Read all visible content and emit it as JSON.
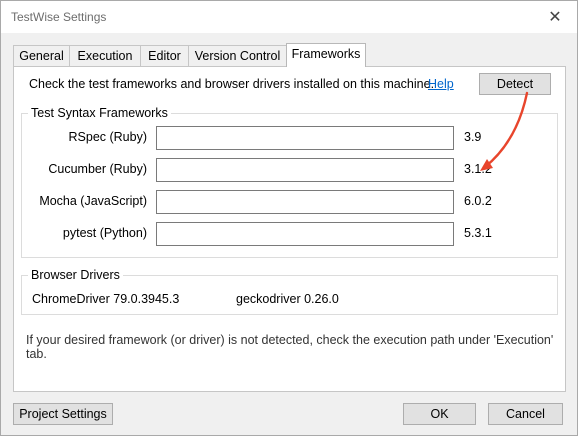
{
  "window": {
    "title": "TestWise Settings"
  },
  "tabs": [
    {
      "label": "General"
    },
    {
      "label": "Execution"
    },
    {
      "label": "Editor"
    },
    {
      "label": "Version Control"
    },
    {
      "label": "Frameworks",
      "active": true
    }
  ],
  "frameworks_tab": {
    "intro": "Check the test frameworks and browser drivers installed on this machine.",
    "help_link": "Help",
    "detect_button": "Detect",
    "syntax_group": {
      "label": "Test Syntax Frameworks",
      "rows": [
        {
          "name": "RSpec (Ruby)",
          "value": "",
          "version": "3.9"
        },
        {
          "name": "Cucumber (Ruby)",
          "value": "",
          "version": "3.1.2"
        },
        {
          "name": "Mocha (JavaScript)",
          "value": "",
          "version": "6.0.2"
        },
        {
          "name": "pytest (Python)",
          "value": "",
          "version": "5.3.1"
        }
      ]
    },
    "drivers_group": {
      "label": "Browser Drivers",
      "chromedriver": "ChromeDriver 79.0.3945.3",
      "geckodriver": "geckodriver 0.26.0"
    },
    "note": "If your desired framework (or driver) is not detected, check the execution path under 'Execution' tab."
  },
  "footer": {
    "project_settings": "Project Settings",
    "ok": "OK",
    "cancel": "Cancel"
  },
  "colors": {
    "annotation_arrow": "#e8452c",
    "link": "#0066cc"
  },
  "icons": {
    "close": "close-icon",
    "annotation": "curved-arrow-icon"
  }
}
